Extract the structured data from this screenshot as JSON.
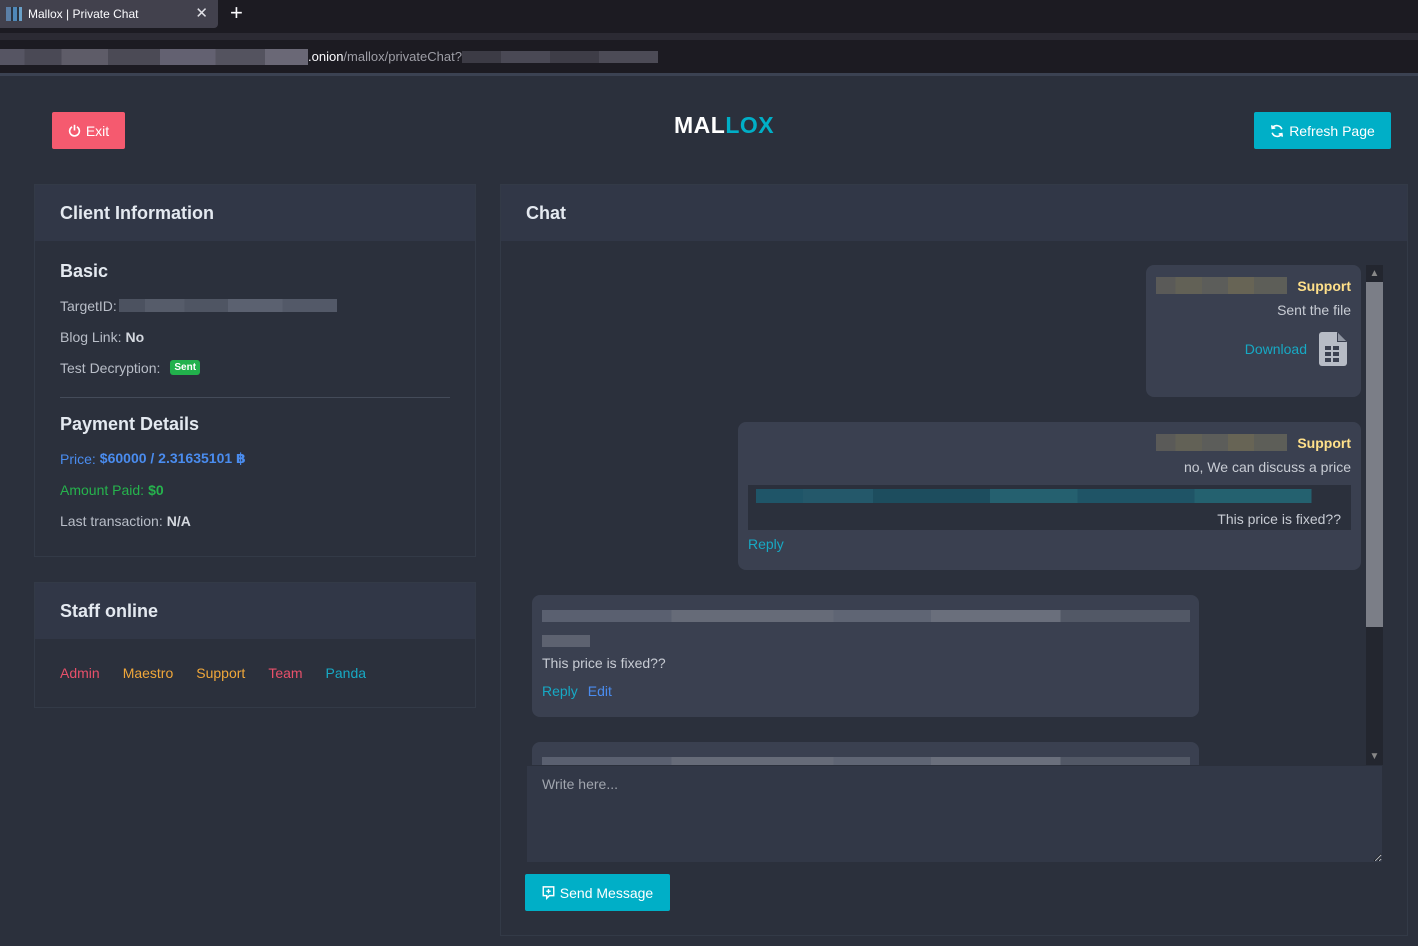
{
  "browser": {
    "tab_title": "Mallox | Private Chat",
    "url_host": ".onion",
    "url_path": "/mallox/privateChat?"
  },
  "header": {
    "exit_label": "Exit",
    "logo_part1": "MAL",
    "logo_part2": "LOX",
    "refresh_label": "Refresh Page"
  },
  "client_info": {
    "title": "Client Information",
    "basic": {
      "title": "Basic",
      "target_id_label": "TargetID:",
      "blog_link_label": "Blog Link:",
      "blog_link_value": "No",
      "test_decryption_label": "Test Decryption:",
      "test_decryption_badge": "Sent"
    },
    "payment": {
      "title": "Payment Details",
      "price_label": "Price:",
      "price_value": "$60000 / 2.31635101 ฿",
      "amount_paid_label": "Amount Paid:",
      "amount_paid_value": "$0",
      "last_tx_label": "Last transaction:",
      "last_tx_value": "N/A"
    }
  },
  "staff": {
    "title": "Staff online",
    "members": [
      {
        "name": "Admin",
        "color": "#e8506a"
      },
      {
        "name": "Maestro",
        "color": "#f0a73a"
      },
      {
        "name": "Support",
        "color": "#f0a73a"
      },
      {
        "name": "Team",
        "color": "#e8506a"
      },
      {
        "name": "Panda",
        "color": "#17a9c4"
      }
    ]
  },
  "chat": {
    "title": "Chat",
    "messages": [
      {
        "sender": "Support",
        "text": "Sent the file",
        "download_label": "Download"
      },
      {
        "sender": "Support",
        "text": "no, We can discuss a price",
        "quoted_text": "This price is fixed??",
        "reply_label": "Reply"
      },
      {
        "text": "This price is fixed??",
        "reply_label": "Reply",
        "edit_label": "Edit"
      }
    ],
    "input_placeholder": "Write here...",
    "send_label": "Send Message"
  },
  "colors": {
    "exit": "#f55a6f",
    "accent": "#00afc7",
    "support_name": "#ffe08a",
    "price": "#4a8cef",
    "paid": "#26b34d"
  }
}
